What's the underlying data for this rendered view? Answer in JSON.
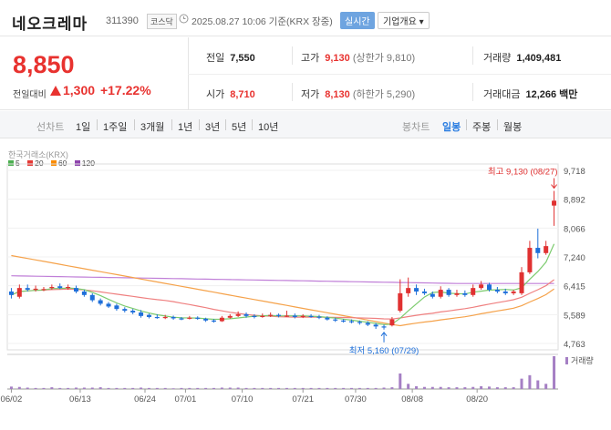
{
  "header": {
    "name": "네오크레마",
    "code": "311390",
    "market": "코스닥",
    "time": "2025.08.27 10:06 기준(KRX 장중)",
    "realtime_btn": "실시간",
    "company_btn": "기업개요 ▾"
  },
  "summary": {
    "price": "8,850",
    "change_label": "전일대비",
    "change": "1,300",
    "change_pct": "+17.22%",
    "prev_label": "전일",
    "prev": "7,550",
    "high_label": "고가",
    "high": "9,130",
    "upper_limit": "(상한가 9,810)",
    "volume_label": "거래량",
    "volume": "1,409,481",
    "open_label": "시가",
    "open": "8,710",
    "low_label": "저가",
    "low": "8,130",
    "lower_limit": "(하한가 5,290)",
    "amount_label": "거래대금",
    "amount": "12,266 백만"
  },
  "toolbar": {
    "line_label": "선차트",
    "periods": [
      "1일",
      "1주일",
      "3개월",
      "1년",
      "3년",
      "5년",
      "10년"
    ],
    "candle_label": "봉차트",
    "candles": [
      "일봉",
      "주봉",
      "월봉"
    ],
    "active_candle": "일봉"
  },
  "chart_data": {
    "type": "candlestick",
    "source_label": "한국거래소(KRX)",
    "ma_legend": [
      {
        "name": "5",
        "color": "#4caf50"
      },
      {
        "name": "20",
        "color": "#e53935"
      },
      {
        "name": "60",
        "color": "#fb8c00"
      },
      {
        "name": "120",
        "color": "#8e44ad"
      }
    ],
    "y_ticks": [
      9718,
      8892,
      8066,
      7240,
      6415,
      5589,
      4763
    ],
    "y_tick_labels": [
      "9,718",
      "8,892",
      "8,066",
      "7,240",
      "6,415",
      "5,589",
      "4,763"
    ],
    "x_labels": [
      "06/02",
      "06/13",
      "06/24",
      "07/01",
      "07/10",
      "07/21",
      "07/30",
      "08/08",
      "08/20"
    ],
    "high_annotation": "최고 9,130 (08/27)",
    "low_annotation": "최저 5,160 (07/29)",
    "volume_label": "거래량",
    "candles": [
      {
        "o": 6250,
        "c": 6150,
        "h": 6350,
        "l": 6050
      },
      {
        "o": 6100,
        "c": 6350,
        "h": 6450,
        "l": 6050
      },
      {
        "o": 6350,
        "c": 6300,
        "h": 6450,
        "l": 6250
      },
      {
        "o": 6300,
        "c": 6330,
        "h": 6420,
        "l": 6250
      },
      {
        "o": 6300,
        "c": 6320,
        "h": 6380,
        "l": 6260
      },
      {
        "o": 6350,
        "c": 6380,
        "h": 6450,
        "l": 6300
      },
      {
        "o": 6400,
        "c": 6350,
        "h": 6480,
        "l": 6320
      },
      {
        "o": 6350,
        "c": 6380,
        "h": 6450,
        "l": 6300
      },
      {
        "o": 6350,
        "c": 6250,
        "h": 6420,
        "l": 6200
      },
      {
        "o": 6250,
        "c": 6150,
        "h": 6300,
        "l": 6100
      },
      {
        "o": 6150,
        "c": 6000,
        "h": 6200,
        "l": 5950
      },
      {
        "o": 6000,
        "c": 5900,
        "h": 6050,
        "l": 5850
      },
      {
        "o": 5900,
        "c": 5820,
        "h": 5950,
        "l": 5780
      },
      {
        "o": 5850,
        "c": 5750,
        "h": 5900,
        "l": 5700
      },
      {
        "o": 5750,
        "c": 5700,
        "h": 5800,
        "l": 5650
      },
      {
        "o": 5700,
        "c": 5650,
        "h": 5750,
        "l": 5600
      },
      {
        "o": 5650,
        "c": 5550,
        "h": 5720,
        "l": 5500
      },
      {
        "o": 5580,
        "c": 5520,
        "h": 5620,
        "l": 5480
      },
      {
        "o": 5520,
        "c": 5500,
        "h": 5600,
        "l": 5470
      },
      {
        "o": 5500,
        "c": 5520,
        "h": 5580,
        "l": 5460
      },
      {
        "o": 5520,
        "c": 5480,
        "h": 5560,
        "l": 5440
      },
      {
        "o": 5480,
        "c": 5470,
        "h": 5520,
        "l": 5430
      },
      {
        "o": 5480,
        "c": 5500,
        "h": 5550,
        "l": 5450
      },
      {
        "o": 5500,
        "c": 5480,
        "h": 5540,
        "l": 5440
      },
      {
        "o": 5470,
        "c": 5420,
        "h": 5500,
        "l": 5380
      },
      {
        "o": 5420,
        "c": 5400,
        "h": 5460,
        "l": 5360
      },
      {
        "o": 5400,
        "c": 5500,
        "h": 5550,
        "l": 5380
      },
      {
        "o": 5500,
        "c": 5550,
        "h": 5600,
        "l": 5470
      },
      {
        "o": 5550,
        "c": 5600,
        "h": 5680,
        "l": 5520
      },
      {
        "o": 5600,
        "c": 5550,
        "h": 5650,
        "l": 5500
      },
      {
        "o": 5550,
        "c": 5520,
        "h": 5600,
        "l": 5480
      },
      {
        "o": 5520,
        "c": 5550,
        "h": 5620,
        "l": 5500
      },
      {
        "o": 5550,
        "c": 5580,
        "h": 5650,
        "l": 5520
      },
      {
        "o": 5580,
        "c": 5550,
        "h": 5620,
        "l": 5510
      },
      {
        "o": 5550,
        "c": 5560,
        "h": 5700,
        "l": 5520
      },
      {
        "o": 5560,
        "c": 5520,
        "h": 5620,
        "l": 5480
      },
      {
        "o": 5520,
        "c": 5550,
        "h": 5600,
        "l": 5490
      },
      {
        "o": 5550,
        "c": 5530,
        "h": 5600,
        "l": 5500
      },
      {
        "o": 5530,
        "c": 5500,
        "h": 5580,
        "l": 5460
      },
      {
        "o": 5500,
        "c": 5450,
        "h": 5540,
        "l": 5420
      },
      {
        "o": 5450,
        "c": 5420,
        "h": 5500,
        "l": 5380
      },
      {
        "o": 5420,
        "c": 5400,
        "h": 5460,
        "l": 5360
      },
      {
        "o": 5400,
        "c": 5380,
        "h": 5450,
        "l": 5340
      },
      {
        "o": 5380,
        "c": 5350,
        "h": 5420,
        "l": 5300
      },
      {
        "o": 5350,
        "c": 5300,
        "h": 5400,
        "l": 5260
      },
      {
        "o": 5300,
        "c": 5250,
        "h": 5350,
        "l": 5180
      },
      {
        "o": 5250,
        "c": 5230,
        "h": 5300,
        "l": 5160
      },
      {
        "o": 5280,
        "c": 5450,
        "h": 5520,
        "l": 5250
      },
      {
        "o": 5700,
        "c": 6200,
        "h": 6600,
        "l": 5650
      },
      {
        "o": 6200,
        "c": 6350,
        "h": 6650,
        "l": 6100
      },
      {
        "o": 6350,
        "c": 6250,
        "h": 6450,
        "l": 6150
      },
      {
        "o": 6250,
        "c": 6200,
        "h": 6330,
        "l": 6150
      },
      {
        "o": 6180,
        "c": 6100,
        "h": 6250,
        "l": 6050
      },
      {
        "o": 6100,
        "c": 6300,
        "h": 6400,
        "l": 6050
      },
      {
        "o": 6300,
        "c": 6150,
        "h": 6350,
        "l": 6100
      },
      {
        "o": 6150,
        "c": 6200,
        "h": 6300,
        "l": 6100
      },
      {
        "o": 6200,
        "c": 6150,
        "h": 6280,
        "l": 6100
      },
      {
        "o": 6150,
        "c": 6350,
        "h": 6450,
        "l": 6100
      },
      {
        "o": 6350,
        "c": 6450,
        "h": 6550,
        "l": 6300
      },
      {
        "o": 6450,
        "c": 6300,
        "h": 6500,
        "l": 6250
      },
      {
        "o": 6300,
        "c": 6250,
        "h": 6380,
        "l": 6200
      },
      {
        "o": 6250,
        "c": 6200,
        "h": 6330,
        "l": 6150
      },
      {
        "o": 6200,
        "c": 6250,
        "h": 6300,
        "l": 6150
      },
      {
        "o": 6200,
        "c": 6800,
        "h": 6950,
        "l": 6150
      },
      {
        "o": 6800,
        "c": 7500,
        "h": 7700,
        "l": 6750
      },
      {
        "o": 7500,
        "c": 7350,
        "h": 8050,
        "l": 7200
      },
      {
        "o": 7350,
        "c": 7550,
        "h": 7700,
        "l": 7300
      },
      {
        "o": 8710,
        "c": 8850,
        "h": 9130,
        "l": 8130
      }
    ],
    "volumes": [
      0.7,
      0.6,
      0.4,
      0.3,
      0.3,
      0.5,
      0.3,
      0.3,
      0.4,
      0.4,
      0.4,
      0.5,
      0.3,
      0.3,
      0.3,
      0.3,
      0.4,
      0.3,
      0.3,
      0.3,
      0.2,
      0.3,
      0.3,
      0.3,
      0.3,
      0.3,
      0.4,
      0.4,
      0.4,
      0.3,
      0.3,
      0.3,
      0.3,
      0.3,
      0.3,
      0.3,
      0.3,
      0.3,
      0.3,
      0.3,
      0.3,
      0.3,
      0.3,
      0.3,
      0.3,
      0.3,
      0.4,
      0.5,
      4.5,
      1.5,
      0.8,
      0.6,
      0.6,
      0.6,
      0.5,
      0.5,
      0.5,
      0.6,
      0.8,
      0.7,
      0.5,
      0.5,
      0.5,
      3.0,
      4.0,
      2.5,
      1.5,
      9.5
    ]
  }
}
